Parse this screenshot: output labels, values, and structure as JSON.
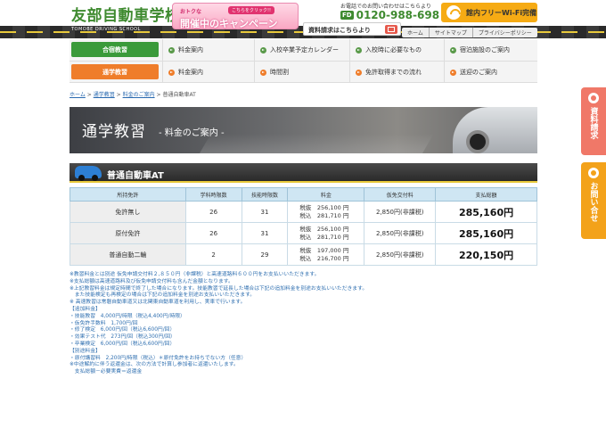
{
  "header": {
    "logo_title": "友部自動車学校",
    "logo_subtitle": "TOMOBE DRIVING SCHOOL",
    "campaign_small": "おトクな",
    "campaign_click": "こちらをクリック!!",
    "campaign_big": "開催中のキャンペーン",
    "phone_label": "お電話でのお問い合わせはこちらより",
    "phone_fd": "FD",
    "phone_number": "0120-988-698",
    "wifi_label": "館内フリーWi-Fi完備",
    "request_label": "資料請求はこちらより",
    "toplinks": [
      "ホーム",
      "サイトマップ",
      "プライバシーポリシー"
    ]
  },
  "nav": {
    "row1_tag": "合宿教習",
    "row1_items": [
      "料金案内",
      "入校卒業予定カレンダー",
      "入校時に必要なもの",
      "宿泊施設のご案内"
    ],
    "row2_tag": "通学教習",
    "row2_items": [
      "料金案内",
      "時間割",
      "免許取得までの流れ",
      "送迎のご案内"
    ]
  },
  "breadcrumb": {
    "items": [
      "ホーム",
      "通学教習",
      "料金のご案内"
    ],
    "current": "普通自動車AT",
    "sep": ">"
  },
  "hero": {
    "title": "通学教習",
    "subtitle": "- 料金のご案内 -"
  },
  "section": {
    "title": "普通自動車AT"
  },
  "table": {
    "headers": [
      "所持免許",
      "学科時限数",
      "技能時限数",
      "料金",
      "仮免交付料",
      "支払総額"
    ],
    "rows": [
      {
        "license": "免許無し",
        "theory": "26",
        "skill": "31",
        "fee_ex": "税抜　256,100 円",
        "fee_in": "税込　281,710 円",
        "permit": "2,850円(非課税)",
        "total": "285,160円"
      },
      {
        "license": "原付免許",
        "theory": "26",
        "skill": "31",
        "fee_ex": "税抜　256,100 円",
        "fee_in": "税込　281,710 円",
        "permit": "2,850円(非課税)",
        "total": "285,160円"
      },
      {
        "license": "普通自動二輪",
        "theory": "2",
        "skill": "29",
        "fee_ex": "税抜　197,000 円",
        "fee_in": "税込　216,700 円",
        "permit": "2,850円(非課税)",
        "total": "220,150円"
      }
    ]
  },
  "notes": [
    "※教習料金とは別途 仮免申請交付料２,８５０円（非課税）と高速道路料６００円をお支払いいただきます。",
    "※支払総額は高速道路料及び仮免申請交付料も含んだ金額となります。",
    "※上記教習料金は規定時間で終了した場合になります。技能教習で延長した場合は下記の追加料金を別途お支払いいただきます。",
    "　また技能検定も再検定の場合は下記の追加料金を別途お支払いいただきます。",
    "※ 高速教習は常磐自動車道又は北関東自動車道を利用し、実車で行います。",
    "【追加料金】",
    "・技能教習　4,000円/時限（税込4,400円/時限）",
    "・仮免許手数料　1,700円/回",
    "・修了検定　6,000円/回（税込6,600円/回）",
    "・効果テスト代　273円/回（税込300円/回）",
    "・卒業検定　6,000円/回（税込6,600円/回）",
    "【別途料金】",
    "・原付講習料　2,200円/時限（税込）＊原付免許をお持ちでない方（任意）",
    "※中途解約に伴う返還金は、次の方法で計算し参加者に返還いたします。",
    "　支払総額－必要実費＝返還金"
  ],
  "side": {
    "tab1": "資料請求",
    "tab2": "お問い合せ"
  }
}
